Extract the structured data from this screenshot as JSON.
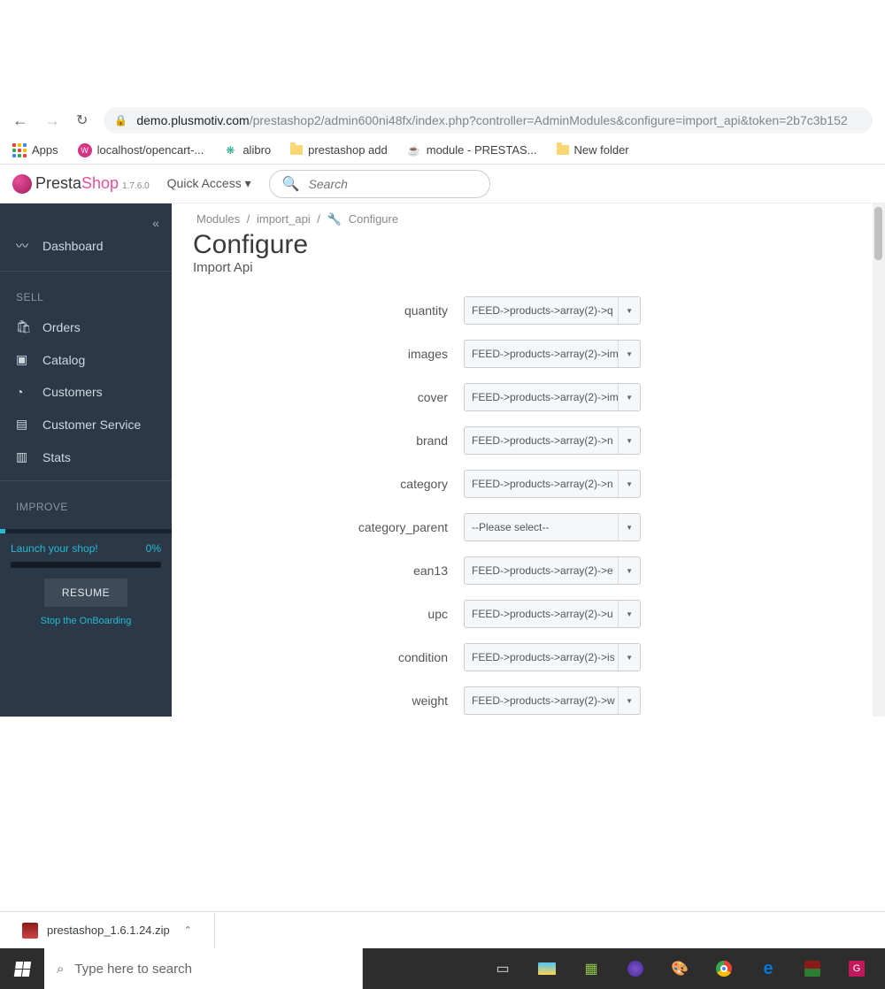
{
  "browser": {
    "url_domain": "demo.plusmotiv.com",
    "url_path": "/prestashop2/admin600ni48fx/index.php?controller=AdminModules&configure=import_api&token=2b7c3b152",
    "bookmarks": [
      {
        "label": "Apps",
        "icon": "apps"
      },
      {
        "label": "localhost/opencart-...",
        "icon": "w"
      },
      {
        "label": "alibro",
        "icon": "alibro"
      },
      {
        "label": "prestashop add",
        "icon": "folder"
      },
      {
        "label": "module - PRESTAS...",
        "icon": "java"
      },
      {
        "label": "New folder",
        "icon": "folder"
      }
    ]
  },
  "header": {
    "brand_a": "Presta",
    "brand_b": "Shop",
    "version": "1.7.6.0",
    "quick_access": "Quick Access",
    "search_placeholder": "Search"
  },
  "sidebar": {
    "dashboard": "Dashboard",
    "section_sell": "SELL",
    "items_sell": [
      "Orders",
      "Catalog",
      "Customers",
      "Customer Service",
      "Stats"
    ],
    "section_improve": "IMPROVE",
    "launch_label": "Launch your shop!",
    "launch_pct": "0%",
    "resume": "RESUME",
    "stop": "Stop the OnBoarding"
  },
  "breadcrumb": {
    "a": "Modules",
    "b": "import_api",
    "c": "Configure"
  },
  "page": {
    "title": "Configure",
    "subtitle": "Import Api"
  },
  "form_rows": [
    {
      "label": "quantity",
      "value": "FEED->products->array(2)->q"
    },
    {
      "label": "images",
      "value": "FEED->products->array(2)->im"
    },
    {
      "label": "cover",
      "value": "FEED->products->array(2)->im"
    },
    {
      "label": "brand",
      "value": "FEED->products->array(2)->n"
    },
    {
      "label": "category",
      "value": "FEED->products->array(2)->n"
    },
    {
      "label": "category_parent",
      "value": "--Please select--"
    },
    {
      "label": "ean13",
      "value": "FEED->products->array(2)->e"
    },
    {
      "label": "upc",
      "value": "FEED->products->array(2)->u"
    },
    {
      "label": "condition",
      "value": "FEED->products->array(2)->is"
    },
    {
      "label": "weight",
      "value": "FEED->products->array(2)->w"
    }
  ],
  "download": {
    "filename": "prestashop_1.6.1.24.zip"
  },
  "taskbar": {
    "search_placeholder": "Type here to search"
  }
}
